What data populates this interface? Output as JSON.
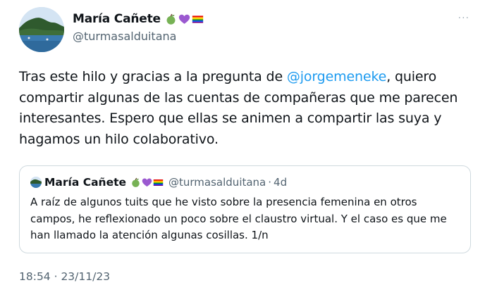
{
  "author": {
    "name": "María Cañete",
    "handle": "@turmasalduitana",
    "emojis": [
      "green-apple-icon",
      "purple-heart-icon",
      "rainbow-flag-icon"
    ]
  },
  "menu": {
    "more_label": "···"
  },
  "tweet": {
    "text_before": "Tras este hilo y gracias a la pregunta de ",
    "mention": "@jorgemeneke",
    "text_after": ", quiero compartir algunas de las cuentas de compañeras que me parecen interesantes. Espero que ellas se animen a compartir las suya y hagamos un hilo colaborativo."
  },
  "quote": {
    "name": "María Cañete",
    "handle": "@turmasalduitana",
    "separator": "·",
    "age": "4d",
    "text": "A raíz de algunos tuits que he visto sobre la presencia femenina en otros campos, he reflexionado un poco sobre el claustro virtual. Y el caso es que me han llamado la atención algunas cosillas. 1/n"
  },
  "footer": {
    "timestamp": "18:54 · 23/11/23"
  },
  "colors": {
    "text": "#0f1419",
    "secondary": "#536471",
    "link": "#1d9bf0",
    "border": "#cfd9de"
  }
}
